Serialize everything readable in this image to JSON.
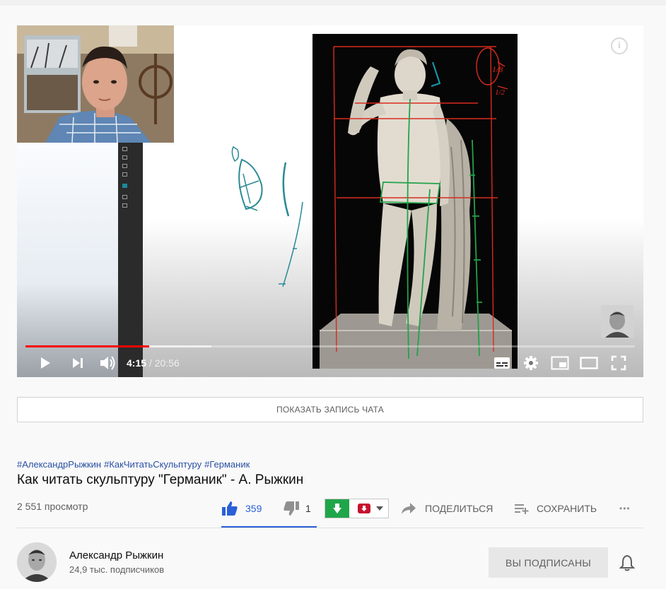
{
  "player": {
    "time_current": "4:15",
    "time_separator": " / ",
    "time_total": "20:56",
    "progress_played": 0.203,
    "progress_buffered": 0.305,
    "info_glyph": "i",
    "icons": [
      "play-icon",
      "next-icon",
      "volume-icon",
      "subtitles-icon",
      "settings-icon",
      "miniplayer-icon",
      "theater-icon",
      "fullscreen-icon",
      "info-icon"
    ]
  },
  "chat": {
    "label": "ПОКАЗАТЬ ЗАПИСЬ ЧАТА"
  },
  "video": {
    "hashtags": [
      "#АлександрРыжкин",
      "#КакЧитатьСкульптуру",
      "#Германик"
    ],
    "title": "Как читать скульптуру \"Германик\" - А. Рыжкин",
    "views": "2 551 просмотр",
    "likes": "359",
    "dislikes": "1",
    "like_ratio": 0.997,
    "share_label": "ПОДЕЛИТЬСЯ",
    "save_label": "СОХРАНИТЬ",
    "more_label": "•••"
  },
  "channel": {
    "name": "Александр Рыжкин",
    "subscribers": "24,9 тыс. подписчиков",
    "subscribe_label": "ВЫ ПОДПИСАНЫ"
  },
  "colors": {
    "progress_red": "#ff0000",
    "like_blue": "#2a5fd8",
    "download_green": "#1fa64a",
    "download_red": "#c8102e",
    "hashtag_blue": "#2a4fa3"
  }
}
